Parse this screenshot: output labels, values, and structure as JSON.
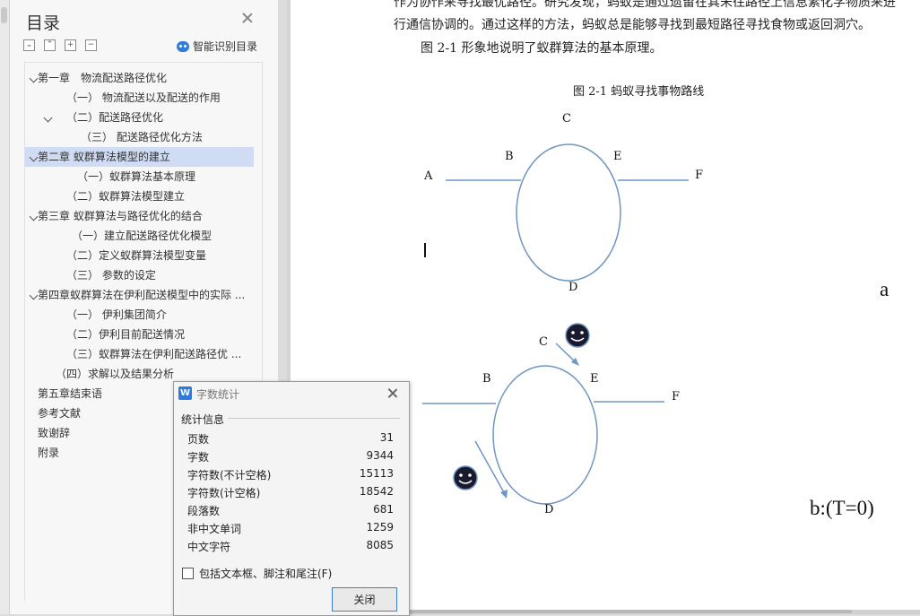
{
  "toc": {
    "title": "目录",
    "smart_label": "智能识别目录",
    "tool_icons": [
      "collapse-all-icon",
      "expand-all-icon",
      "add-icon",
      "remove-icon"
    ],
    "items": [
      {
        "text": "第一章　物流配送路径优化",
        "expanded": true,
        "selected": false
      },
      {
        "text": "（一）  物流配送以及配送的作用",
        "expanded": null,
        "selected": false
      },
      {
        "text": "（二）配送路径优化",
        "expanded": true,
        "selected": false
      },
      {
        "text": "（三）  配送路径优化方法",
        "expanded": null,
        "selected": false
      },
      {
        "text": "第二章  蚁群算法模型的建立",
        "expanded": true,
        "selected": true
      },
      {
        "text": "（一）蚁群算法基本原理",
        "expanded": null,
        "selected": false
      },
      {
        "text": "（二）蚁群算法模型建立",
        "expanded": null,
        "selected": false
      },
      {
        "text": "第三章  蚁群算法与路径优化的结合",
        "expanded": true,
        "selected": false
      },
      {
        "text": "（一）建立配送路径优化模型",
        "expanded": null,
        "selected": false
      },
      {
        "text": "（二）定义蚁群算法模型变量",
        "expanded": null,
        "selected": false
      },
      {
        "text": "（三）  参数的设定",
        "expanded": null,
        "selected": false
      },
      {
        "text": "第四章蚁群算法在伊利配送模型中的实际 ...",
        "expanded": true,
        "selected": false
      },
      {
        "text": "（一）  伊利集团简介",
        "expanded": null,
        "selected": false
      },
      {
        "text": "（二）伊利目前配送情况",
        "expanded": null,
        "selected": false
      },
      {
        "text": "（三）蚁群算法在伊利配送路径优 ...",
        "expanded": null,
        "selected": false
      },
      {
        "text": "（四）求解以及结果分析",
        "expanded": null,
        "selected": false
      },
      {
        "text": "第五章结束语",
        "expanded": null,
        "selected": false
      },
      {
        "text": "参考文献",
        "expanded": null,
        "selected": false
      },
      {
        "text": "致谢辞",
        "expanded": null,
        "selected": false
      },
      {
        "text": "附录",
        "expanded": null,
        "selected": false
      }
    ]
  },
  "document": {
    "line1": "作为协作来寻找最优路径。研究发现，蚂蚁是通过遗留在其未往路径上信息素化学物质来进",
    "line2": "行通信协调的。通过这样的方法，蚂蚁总是能够寻找到最短路径寻找食物或返回洞穴。",
    "line3": "图 2-1 形象地说明了蚁群算法的基本原理。",
    "figure_caption": "图 2-1  蚂蚁寻找事物路线",
    "diagram_a": {
      "labels": [
        "A",
        "B",
        "C",
        "D",
        "E",
        "F"
      ],
      "tag": "a"
    },
    "diagram_b": {
      "labels": [
        "B",
        "C",
        "D",
        "E",
        "F"
      ],
      "tag": "b:(T=0)"
    },
    "ant_icon": "smiley-ant-icon",
    "line_color": "#6f96c4"
  },
  "dialog": {
    "title": "字数统计",
    "logo": "W",
    "group_label": "统计信息",
    "rows": [
      {
        "label": "页数",
        "value": "31"
      },
      {
        "label": "字数",
        "value": "9344"
      },
      {
        "label": "字符数(不计空格)",
        "value": "15113"
      },
      {
        "label": "字符数(计空格)",
        "value": "18542"
      },
      {
        "label": "段落数",
        "value": "681"
      },
      {
        "label": "非中文单词",
        "value": "1259"
      },
      {
        "label": "中文字符",
        "value": "8085"
      }
    ],
    "checkbox_label": "包括文本框、脚注和尾注(F)",
    "checkbox_checked": false,
    "close_button": "关闭"
  }
}
